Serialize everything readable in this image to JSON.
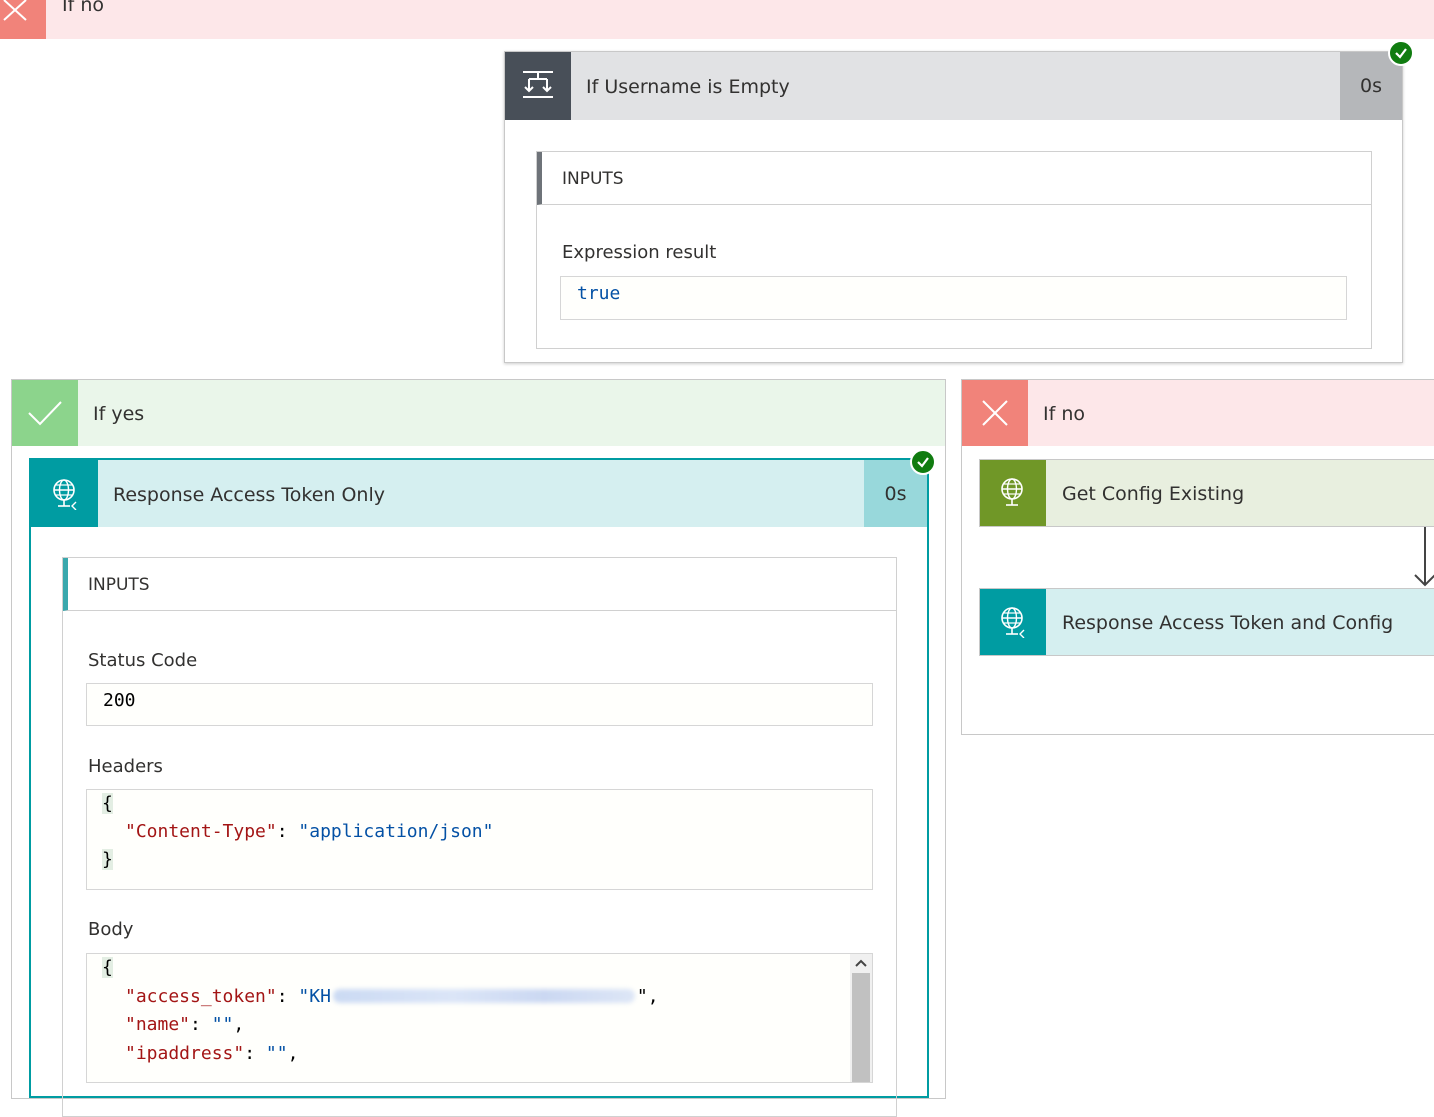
{
  "top_no_branch": {
    "label": "If no"
  },
  "condition": {
    "title": "If Username is Empty",
    "duration": "0s",
    "inputs_header": "INPUTS",
    "expression_label": "Expression result",
    "expression_value": "true"
  },
  "yes_branch": {
    "label": "If yes",
    "action": {
      "title": "Response Access Token Only",
      "duration": "0s",
      "inputs_header": "INPUTS",
      "status_label": "Status Code",
      "status_value": "200",
      "headers_label": "Headers",
      "headers": {
        "open": "{",
        "key": "\"Content-Type\"",
        "sep": ": ",
        "value": "\"application/json\"",
        "close": "}"
      },
      "body_label": "Body",
      "body": {
        "open": "{",
        "lines": [
          {
            "key": "\"access_token\"",
            "sep": ": ",
            "value": "\"KH",
            "tail": "\","
          },
          {
            "key": "\"name\"",
            "sep": ": ",
            "value": "\"\"",
            "tail": ","
          },
          {
            "key": "\"ipaddress\"",
            "sep": ": ",
            "value": "\"\"",
            "tail": ","
          }
        ]
      }
    }
  },
  "no_branch": {
    "label": "If no",
    "actions": [
      {
        "title": "Get Config Existing"
      },
      {
        "title": "Response Access Token and Config"
      }
    ]
  },
  "colors": {
    "no_red": "#f1837a",
    "no_bg": "#fde7e9",
    "yes_green": "#8cd48c",
    "yes_bg": "#eaf6ea",
    "condition_icon": "#484f58",
    "request_teal": "#009ca2",
    "config_green": "#709727",
    "success": "#107c10"
  },
  "icons": {
    "close": "close-icon",
    "check": "checkmark-icon",
    "condition": "condition-icon",
    "globe": "globe-icon",
    "success": "success-check-icon",
    "arrow": "arrow-down-icon",
    "scroll_up": "chevron-up-icon"
  }
}
